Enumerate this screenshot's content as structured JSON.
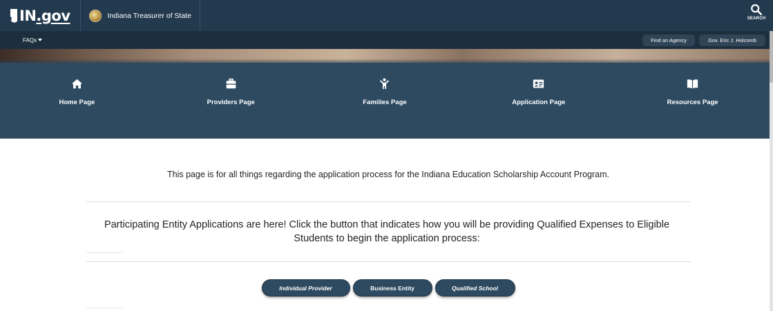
{
  "header": {
    "logo_text_in": "IN",
    "logo_text_gov": ".gov",
    "agency_name": "Indiana Treasurer of State",
    "search_label": "SEARCH",
    "search_icon": "magnifier-icon",
    "bg_color": "#233a4e"
  },
  "subnav": {
    "faqs_label": "FAQs",
    "find_agency_label": "Find an Agency",
    "governor_label": "Gov. Eric J. Holcomb"
  },
  "nav": {
    "bg_color": "#2d4a61",
    "items": [
      {
        "label": "Home Page",
        "icon": "home-icon"
      },
      {
        "label": "Providers Page",
        "icon": "briefcase-icon"
      },
      {
        "label": "Families Page",
        "icon": "child-icon"
      },
      {
        "label": "Application Page",
        "icon": "id-card-icon"
      },
      {
        "label": "Resources Page",
        "icon": "book-icon"
      }
    ]
  },
  "content": {
    "intro": "This page is for all things regarding the application process for the Indiana Education Scholarship Account Program.",
    "heading": "Participating Entity Applications are here! Click the button that indicates how you will be providing Qualified Expenses to Eligible Students to begin the application process:",
    "buttons": {
      "individual": "Individual Provider",
      "business": "Business Entity",
      "qualified": "Qualified School"
    }
  }
}
